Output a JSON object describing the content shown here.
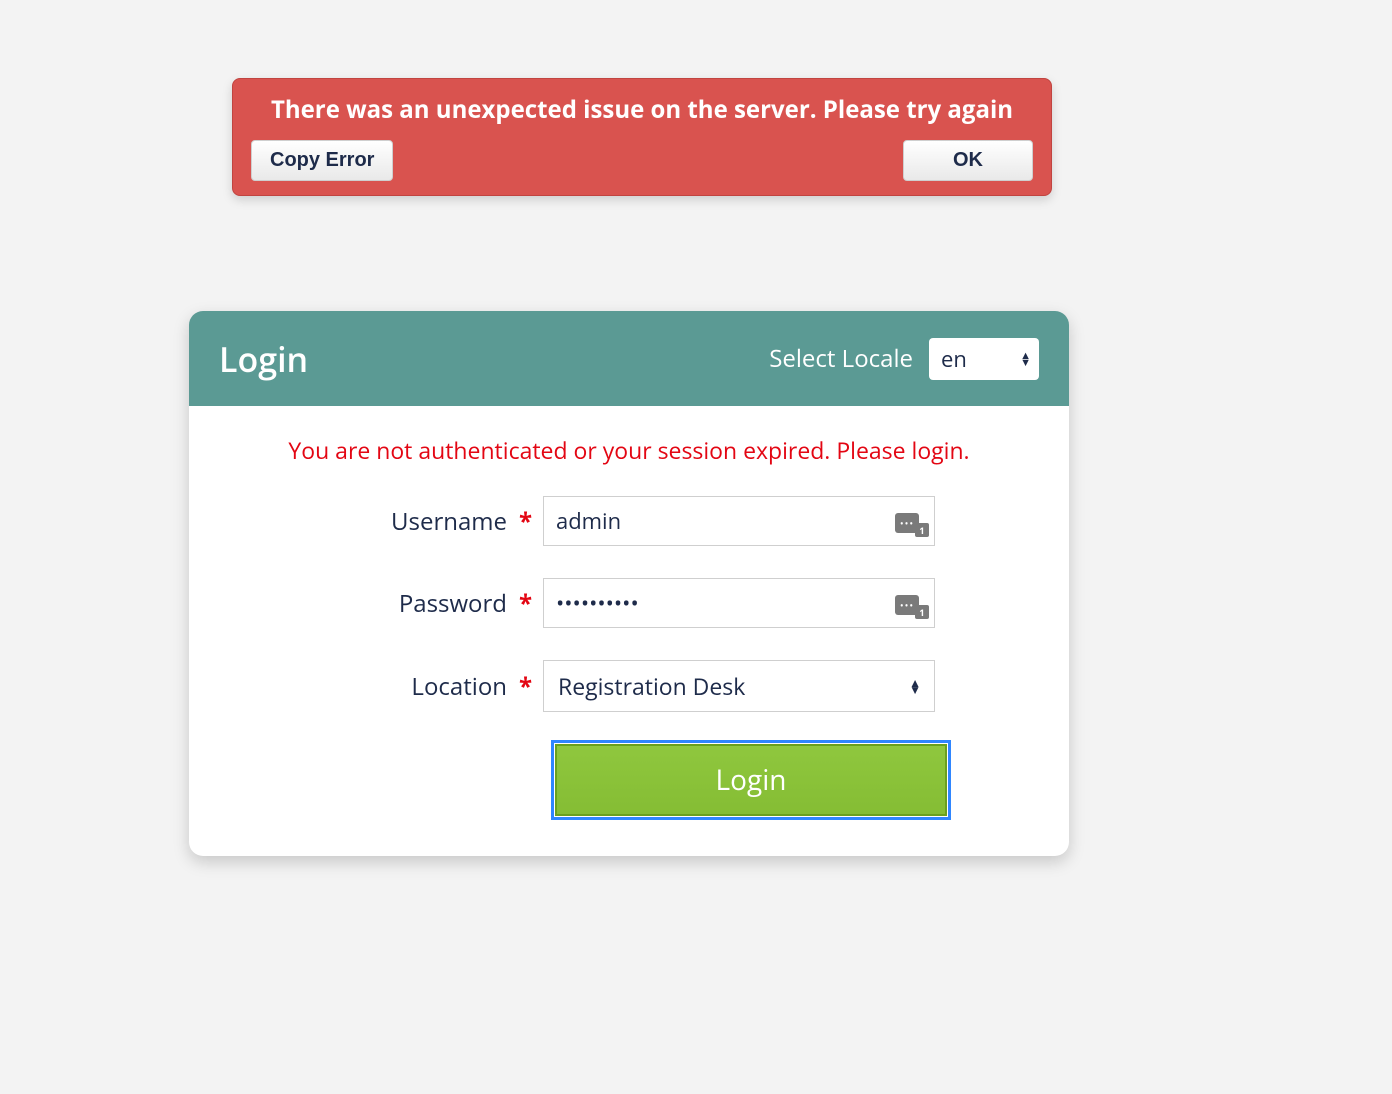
{
  "error_banner": {
    "message": "There was an unexpected issue on the server. Please try again",
    "copy_label": "Copy Error",
    "ok_label": "OK"
  },
  "login": {
    "title": "Login",
    "locale": {
      "label": "Select Locale",
      "selected": "en"
    },
    "session_message": "You are not authenticated or your session expired. Please login.",
    "fields": {
      "username": {
        "label": "Username",
        "value": "admin",
        "required": "*"
      },
      "password": {
        "label": "Password",
        "value": "••••••••••",
        "required": "*"
      },
      "location": {
        "label": "Location",
        "value": "Registration Desk",
        "required": "*"
      }
    },
    "submit_label": "Login",
    "pw_manager_badge": "1"
  }
}
